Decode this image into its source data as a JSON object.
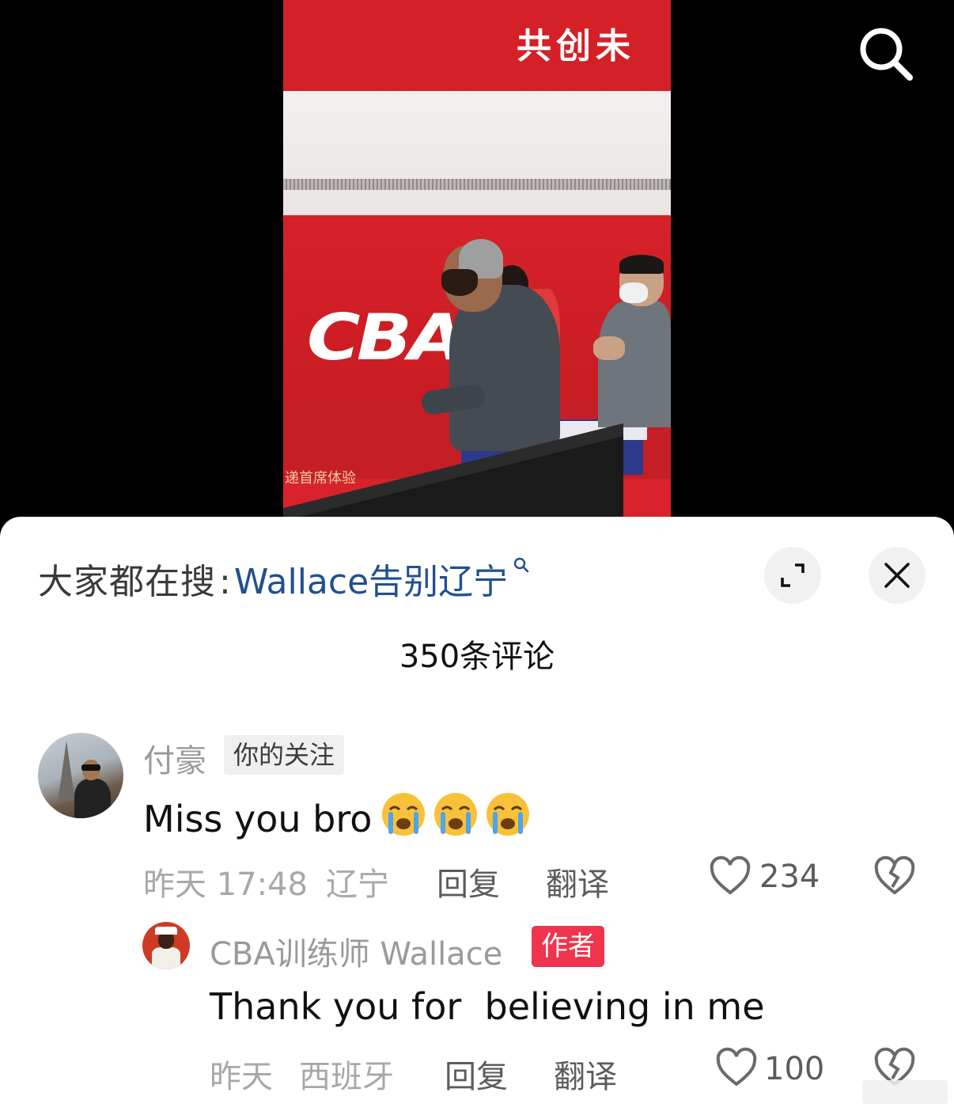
{
  "video": {
    "banner_text": "共创未",
    "logo_text": "CBA",
    "small_text": "递首席体验"
  },
  "hot_search": {
    "prefix": "大家都在搜",
    "colon": ":",
    "query": "Wallace告别辽宁"
  },
  "header": {
    "comment_count": "350条评论"
  },
  "comment": {
    "author": "付豪",
    "follow_tag": "你的关注",
    "text": "Miss you bro",
    "emoji": "😭😭😭",
    "time": "昨天 17:48",
    "location": "辽宁",
    "reply_label": "回复",
    "translate_label": "翻译",
    "likes": "234"
  },
  "reply": {
    "author": "CBA训练师 Wallace",
    "author_tag": "作者",
    "text": "Thank you for  believing in me",
    "time": "昨天",
    "location": "西班牙",
    "reply_label": "回复",
    "translate_label": "翻译",
    "likes": "100"
  },
  "colors": {
    "query_link": "#21508f",
    "author_tag": "#f0344d",
    "cba_red": "#d42027"
  },
  "icons": [
    "search-icon",
    "expand-icon",
    "close-icon",
    "heart-icon",
    "dislike-heart-icon"
  ]
}
